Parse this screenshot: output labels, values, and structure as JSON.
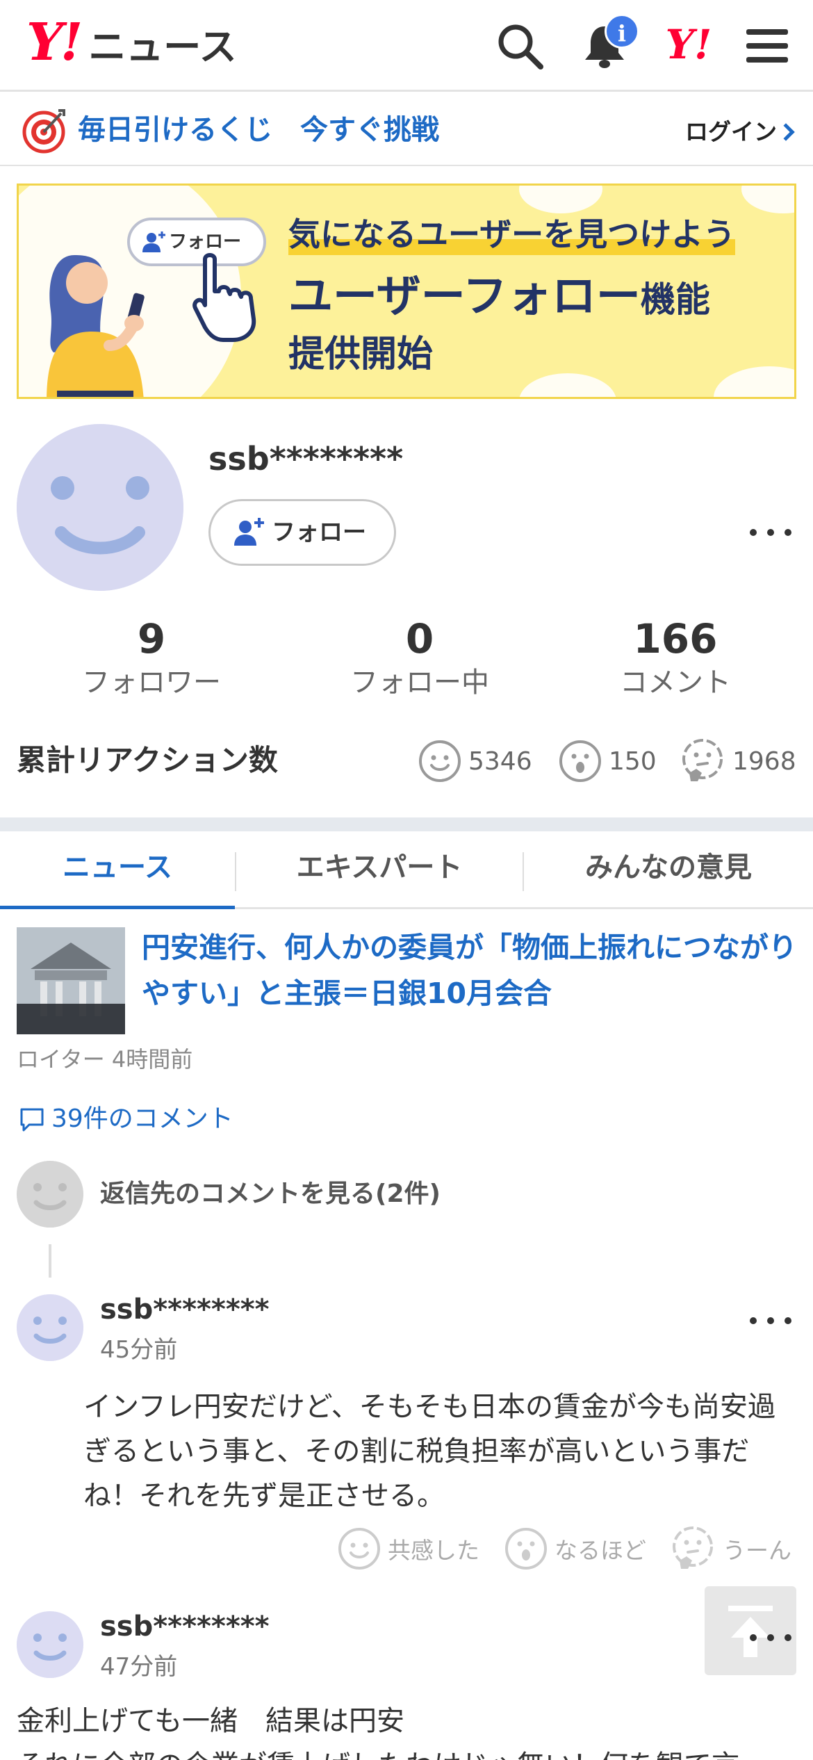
{
  "header": {
    "logo_mark": "Y!",
    "logo_text": "ニュース",
    "notification_badge": "i",
    "yahoo_link": "Y!"
  },
  "promo": {
    "text": "毎日引けるくじ　今すぐ挑戦",
    "login": "ログイン"
  },
  "banner": {
    "pill": "フォロー",
    "line1": "気になるユーザーを見つけよう",
    "line2_main": "ユーザーフォロー",
    "line2_small": "機能",
    "line3": "提供開始"
  },
  "profile": {
    "username": "ssb********",
    "follow_label": "フォロー",
    "stats": [
      {
        "value": "9",
        "label": "フォロワー"
      },
      {
        "value": "0",
        "label": "フォロー中"
      },
      {
        "value": "166",
        "label": "コメント"
      }
    ],
    "reactions_title": "累計リアクション数",
    "reactions": {
      "empathy": "5346",
      "insight": "150",
      "hmm": "1968"
    }
  },
  "tabs": [
    "ニュース",
    "エキスパート",
    "みんなの意見"
  ],
  "article": {
    "title": "円安進行、何人かの委員が「物価上振れにつながりやすい」と主張＝日銀10月会合",
    "meta": "ロイター 4時間前",
    "comments": "39件のコメント",
    "reply_link": "返信先のコメントを見る(2件)"
  },
  "comments": [
    {
      "user": "ssb********",
      "time": "45分前",
      "body": "インフレ円安だけど、そもそも日本の賃金が今も尚安過ぎるという事と、その割に税負担率が高いという事だね！それを先ず是正させる。",
      "actions": [
        "共感した",
        "なるほど",
        "うーん"
      ]
    },
    {
      "user": "ssb********",
      "time": "47分前",
      "body_line1": "金利上げても一緒　結果は円安",
      "body_line2": "それに全部の企業が賃上げしたわけじゃ無い！何を観て言"
    }
  ],
  "colors": {
    "brand_red": "#ff0033",
    "link_blue": "#1d6ac5",
    "avatar_lavender": "#d8d9f1"
  }
}
